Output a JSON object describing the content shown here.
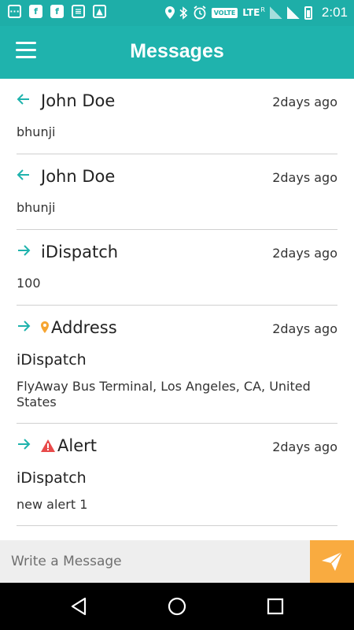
{
  "status_bar": {
    "left_icons": [
      "message-icon",
      "facebook-icon",
      "facebook-icon",
      "news-icon",
      "gallery-icon"
    ],
    "right_icons": [
      "location-icon",
      "bluetooth-icon",
      "alarm-icon"
    ],
    "volte": "VOLTE",
    "lte": "LTE",
    "roaming": "R",
    "time": "2:01"
  },
  "app_bar": {
    "title": "Messages",
    "menu_icon": "hamburger-menu-icon",
    "background": "#1fb3ad"
  },
  "messages": [
    {
      "direction": "incoming",
      "title": "John Doe",
      "time": "2days ago",
      "body": "bhunji"
    },
    {
      "direction": "incoming",
      "title": "John Doe",
      "time": "2days ago",
      "body": "bhunji"
    },
    {
      "direction": "outgoing",
      "title": "iDispatch",
      "time": "2days ago",
      "body": "100"
    },
    {
      "direction": "outgoing",
      "type": "address",
      "title": "Address",
      "time": "2days ago",
      "sender": "iDispatch",
      "body": "FlyAway Bus Terminal, Los Angeles, CA, United States"
    },
    {
      "direction": "outgoing",
      "type": "alert",
      "title": "Alert",
      "time": "2days ago",
      "sender": "iDispatch",
      "body": "new alert 1"
    }
  ],
  "composer": {
    "placeholder": "Write a Message",
    "send_icon": "send-icon",
    "send_color": "#f9ab40"
  },
  "nav_bar": {
    "buttons": [
      "back-icon",
      "home-icon",
      "recents-icon"
    ]
  }
}
